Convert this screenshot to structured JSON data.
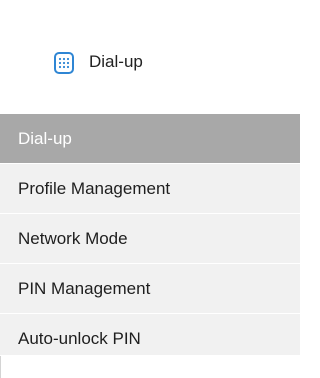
{
  "header": {
    "icon": "dialpad-icon",
    "title": "Dial-up"
  },
  "menu": {
    "items": [
      {
        "label": "Dial-up",
        "active": true
      },
      {
        "label": "Profile Management",
        "active": false
      },
      {
        "label": "Network Mode",
        "active": false
      },
      {
        "label": "PIN Management",
        "active": false
      },
      {
        "label": "Auto-unlock PIN",
        "active": false
      }
    ]
  },
  "colors": {
    "accent_icon": "#2f86d4",
    "active_item_bg": "#a8a8a8",
    "item_bg": "#f1f1f1"
  }
}
